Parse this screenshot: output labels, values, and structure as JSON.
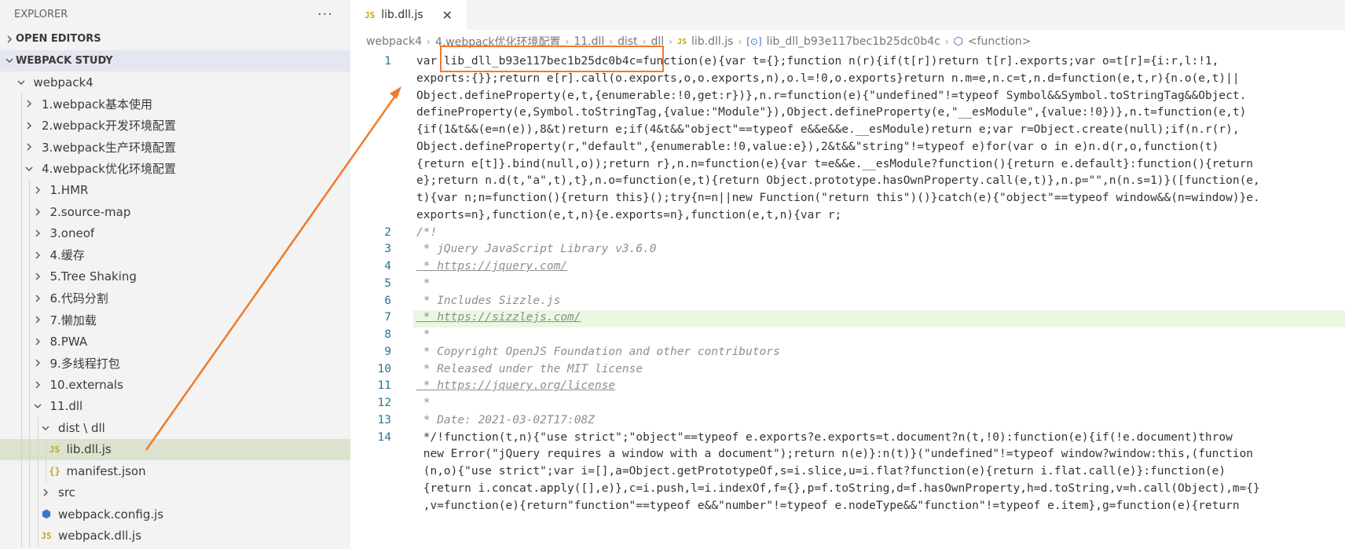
{
  "explorer": {
    "title": "EXPLORER",
    "more_icon": "ellipsis-icon",
    "open_editors": "OPEN EDITORS",
    "workspace": "WEBPACK STUDY",
    "tree": [
      {
        "label": "webpack4",
        "indent": 1,
        "type": "folder",
        "open": true
      },
      {
        "label": "1.webpack基本使用",
        "indent": 2,
        "type": "folder",
        "open": false
      },
      {
        "label": "2.webpack开发环境配置",
        "indent": 2,
        "type": "folder",
        "open": false
      },
      {
        "label": "3.webpack生产环境配置",
        "indent": 2,
        "type": "folder",
        "open": false
      },
      {
        "label": "4.webpack优化环境配置",
        "indent": 2,
        "type": "folder",
        "open": true
      },
      {
        "label": "1.HMR",
        "indent": 3,
        "type": "folder",
        "open": false
      },
      {
        "label": "2.source-map",
        "indent": 3,
        "type": "folder",
        "open": false
      },
      {
        "label": "3.oneof",
        "indent": 3,
        "type": "folder",
        "open": false
      },
      {
        "label": "4.缓存",
        "indent": 3,
        "type": "folder",
        "open": false
      },
      {
        "label": "5.Tree Shaking",
        "indent": 3,
        "type": "folder",
        "open": false
      },
      {
        "label": "6.代码分割",
        "indent": 3,
        "type": "folder",
        "open": false
      },
      {
        "label": "7.懒加载",
        "indent": 3,
        "type": "folder",
        "open": false
      },
      {
        "label": "8.PWA",
        "indent": 3,
        "type": "folder",
        "open": false
      },
      {
        "label": "9.多线程打包",
        "indent": 3,
        "type": "folder",
        "open": false
      },
      {
        "label": "10.externals",
        "indent": 3,
        "type": "folder",
        "open": false
      },
      {
        "label": "11.dll",
        "indent": 3,
        "type": "folder",
        "open": true
      },
      {
        "label": "dist \\ dll",
        "indent": 4,
        "type": "folder",
        "open": true
      },
      {
        "label": "lib.dll.js",
        "indent": 5,
        "type": "js",
        "selected": true
      },
      {
        "label": "manifest.json",
        "indent": 5,
        "type": "json"
      },
      {
        "label": "src",
        "indent": 4,
        "type": "folder",
        "open": false
      },
      {
        "label": "webpack.config.js",
        "indent": 4,
        "type": "config"
      },
      {
        "label": "webpack.dll.js",
        "indent": 4,
        "type": "js"
      }
    ]
  },
  "tab": {
    "label": "lib.dll.js",
    "icon": "JS",
    "close_icon": "close-icon"
  },
  "breadcrumbs": [
    "webpack4",
    "4.webpack优化环境配置",
    "11.dll",
    "dist",
    "dll",
    "lib.dll.js",
    "lib_dll_b93e117bec1b25dc0b4c",
    "<function>"
  ],
  "code": {
    "line_numbers": [
      "1",
      "2",
      "3",
      "4",
      "5",
      "6",
      "7",
      "8",
      "9",
      "10",
      "11",
      "12",
      "13",
      "14"
    ],
    "line1": [
      "var lib_dll_b93e117bec1b25dc0b4c=function(e){var t={};function n(r){if(t[r])return t[r].exports;var o=t[r]={i:r,l:!1,",
      "exports:{}};return e[r].call(o.exports,o,o.exports,n),o.l=!0,o.exports}return n.m=e,n.c=t,n.d=function(e,t,r){n.o(e,t)||",
      "Object.defineProperty(e,t,{enumerable:!0,get:r})},n.r=function(e){\"undefined\"!=typeof Symbol&&Symbol.toStringTag&&Object.",
      "defineProperty(e,Symbol.toStringTag,{value:\"Module\"}),Object.defineProperty(e,\"__esModule\",{value:!0})},n.t=function(e,t)",
      "{if(1&t&&(e=n(e)),8&t)return e;if(4&t&&\"object\"==typeof e&&e&&e.__esModule)return e;var r=Object.create(null);if(n.r(r),",
      "Object.defineProperty(r,\"default\",{enumerable:!0,value:e}),2&t&&\"string\"!=typeof e)for(var o in e)n.d(r,o,function(t)",
      "{return e[t]}.bind(null,o));return r},n.n=function(e){var t=e&&e.__esModule?function(){return e.default}:function(){return",
      "e};return n.d(t,\"a\",t),t},n.o=function(e,t){return Object.prototype.hasOwnProperty.call(e,t)},n.p=\"\",n(n.s=1)}([function(e,",
      "t){var n;n=function(){return this}();try{n=n||new Function(\"return this\")()}catch(e){\"object\"==typeof window&&(n=window)}e.",
      "exports=n},function(e,t,n){e.exports=n},function(e,t,n){var r;"
    ],
    "comment_lines": [
      "/*!",
      " * jQuery JavaScript Library v3.6.0",
      " * https://jquery.com/",
      " *",
      " * Includes Sizzle.js",
      " * https://sizzlejs.com/",
      " *",
      " * Copyright OpenJS Foundation and other contributors",
      " * Released under the MIT license",
      " * https://jquery.org/license",
      " *",
      " * Date: 2021-03-02T17:08Z"
    ],
    "line14": [
      " */!function(t,n){\"use strict\";\"object\"==typeof e.exports?e.exports=t.document?n(t,!0):function(e){if(!e.document)throw",
      " new Error(\"jQuery requires a window with a document\");return n(e)}:n(t)}(\"undefined\"!=typeof window?window:this,(function",
      " (n,o){\"use strict\";var i=[],a=Object.getPrototypeOf,s=i.slice,u=i.flat?function(e){return i.flat.call(e)}:function(e)",
      " {return i.concat.apply([],e)},c=i.push,l=i.indexOf,f={},p=f.toString,d=f.hasOwnProperty,h=d.toString,v=h.call(Object),m={}",
      " ,v=function(e){return\"function\"==typeof e&&\"number\"!=typeof e.nodeType&&\"function\"!=typeof e.item},g=function(e){return"
    ]
  },
  "annotation": {
    "color": "#f07a28",
    "highlight": "lib_dll_b93e117bec1b25dc0b4c"
  }
}
